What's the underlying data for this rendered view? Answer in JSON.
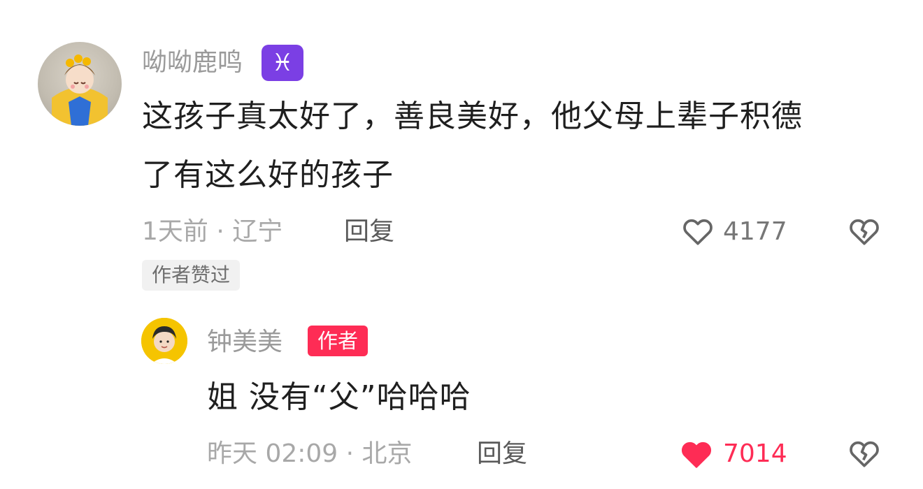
{
  "comment": {
    "username": "呦呦鹿鸣",
    "zodiac_badge": "♓",
    "text_line1": "这孩子真太好了，善良美好，他父母上辈子积德",
    "text_line2": "了有这么好的孩子",
    "meta": "1天前 · 辽宁",
    "reply_label": "回复",
    "likes": "4177",
    "liked_by_author": "作者赞过"
  },
  "reply": {
    "username": "钟美美",
    "author_tag": "作者",
    "text": "姐 没有“父”哈哈哈",
    "meta": "昨天 02:09 · 北京",
    "reply_label": "回复",
    "likes": "7014"
  },
  "colors": {
    "accent": "#fe2c55",
    "muted": "#a8a8a8",
    "badge_purple": "#7b3fe4"
  },
  "icons": {
    "like": "heart-outline-icon",
    "liked": "heart-filled-icon",
    "dislike": "broken-heart-icon"
  }
}
